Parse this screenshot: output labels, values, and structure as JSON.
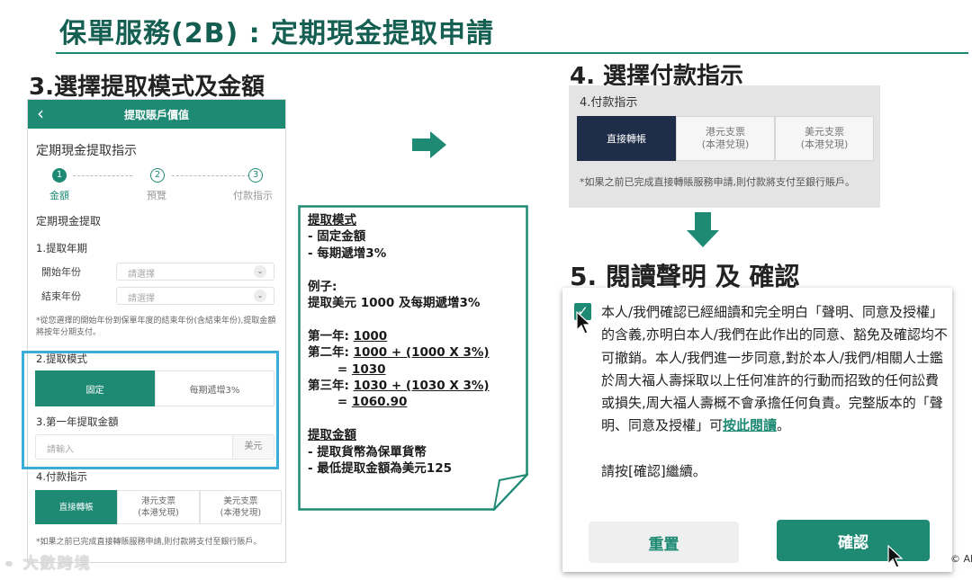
{
  "page": {
    "title": "保單服務(2B) : 定期現金提取申請",
    "section3": "3.選擇提取模式及金額",
    "section4": "4. 選擇付款指示",
    "section5": "5. 閱讀聲明 及 確認",
    "watermark": "大數跨境",
    "copyright": "© All"
  },
  "phone": {
    "header_title": "提取賬戶價值",
    "heading": "定期現金提取指示",
    "steps": [
      {
        "num": "1",
        "label": "金額"
      },
      {
        "num": "2",
        "label": "預覽"
      },
      {
        "num": "3",
        "label": "付款指示"
      }
    ],
    "subheading": "定期現金提取",
    "year_section": "1.提取年期",
    "start_year_label": "開始年份",
    "end_year_label": "結束年份",
    "select_placeholder": "請選擇",
    "year_note": "*從您選擇的開始年份到保單年度的結束年份(含結束年份),提取金額將按年分期支付。",
    "mode_section": "2.提取模式",
    "mode_options": [
      "固定",
      "每期遞增3%"
    ],
    "amount_section": "3.第一年提取金額",
    "amount_placeholder": "請輸入",
    "amount_currency": "美元",
    "payment_section": "4.付款指示",
    "payment_options": [
      {
        "line1": "直接轉帳",
        "line2": ""
      },
      {
        "line1": "港元支票",
        "line2": "(本港兌現)"
      },
      {
        "line1": "美元支票",
        "line2": "(本港兌現)"
      }
    ],
    "payment_note": "*如果之前已完成直接轉賬服務申請,則付款將支付至銀行賬戶。"
  },
  "note": {
    "mode_title": "提取模式",
    "mode_items": [
      "- 固定金額",
      "- 每期遞增3%"
    ],
    "example_title": "例子:",
    "example_desc": "提取美元 1000 及每期遞增3%",
    "year1_label": "第一年:",
    "year1_value": "1000",
    "year2_label": "第二年:",
    "year2_formula": "1000 + (1000 X 3%)",
    "year2_eq": "= ",
    "year2_result": "1030",
    "year3_label": "第三年:",
    "year3_formula": "1030 + (1030 X 3%)",
    "year3_eq": "= ",
    "year3_result": "1060.90",
    "amount_title": "提取金額",
    "amount_items": [
      "- 提取貨幣為保單貨幣",
      "- 最低提取金額為美元125"
    ]
  },
  "payment_panel": {
    "label": "4.付款指示",
    "options": [
      {
        "line1": "直接轉帳",
        "line2": ""
      },
      {
        "line1": "港元支票",
        "line2": "(本港兌現)"
      },
      {
        "line1": "美元支票",
        "line2": "(本港兌現)"
      }
    ],
    "note": "*如果之前已完成直接轉賬服務申請,則付款將支付至銀行賬戶。"
  },
  "declaration": {
    "checked": true,
    "text_main": "本人/我們確認已經細讀和完全明白「聲明、同意及授權」的含義,亦明白本人/我們在此作出的同意、豁免及確認均不可撤銷。本人/我們進一步同意,對於本人/我們/相關人士鑑於周大福人壽採取以上任何准許的行動而招致的任何訟費或損失,周大福人壽概不會承擔任何負責。完整版本的「聲明、同意及授權」可",
    "link_text": "按此閱讀",
    "text_end": "。",
    "continue_text": "請按[確認]繼續。",
    "reset_label": "重置",
    "confirm_label": "確認"
  },
  "colors": {
    "accent": "#1e8a74",
    "dark_title": "#155f52",
    "highlight": "#3aaed8",
    "navy": "#1f2d48"
  }
}
